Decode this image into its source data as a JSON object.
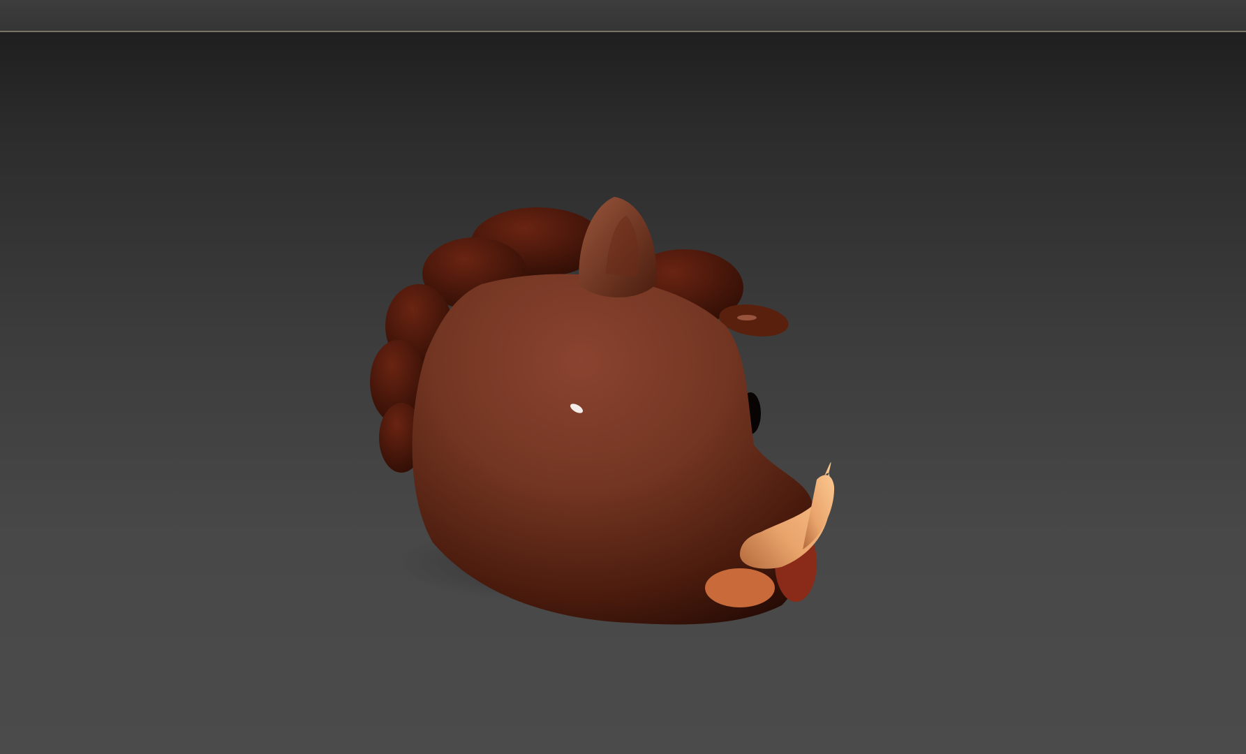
{
  "window": {
    "title": ""
  },
  "viewport": {
    "model": "cartoon-boar-head",
    "colors": {
      "background_top": "#1f1f1f",
      "background_bottom": "#4b4b4b",
      "skin": "#7a3a22",
      "skin_shadow": "#3a150a",
      "mane": "#5a1f0e",
      "tusk": "#f0b07a",
      "ear": "#8a4a32"
    }
  }
}
